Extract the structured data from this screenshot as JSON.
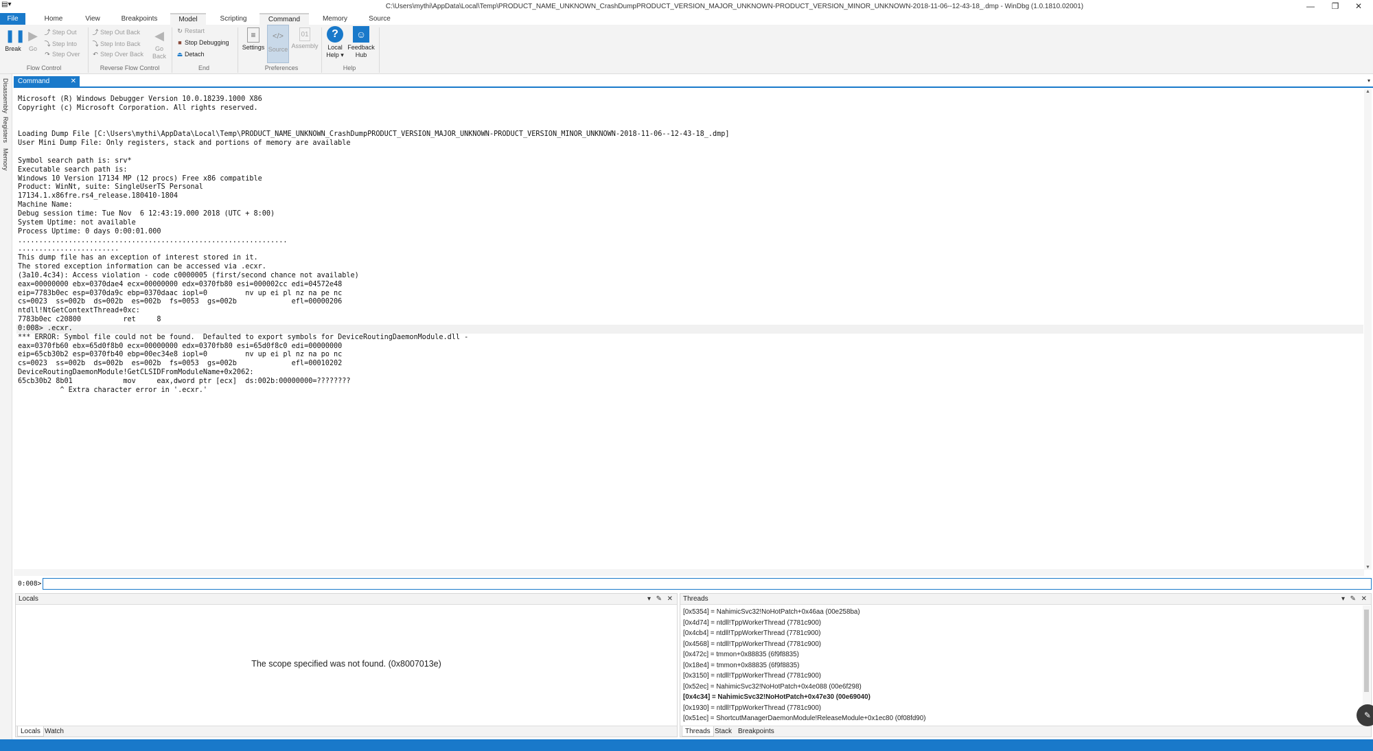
{
  "window": {
    "title": "C:\\Users\\mythi\\AppData\\Local\\Temp\\PRODUCT_NAME_UNKNOWN_CrashDumpPRODUCT_VERSION_MAJOR_UNKNOWN-PRODUCT_VERSION_MINOR_UNKNOWN-2018-11-06--12-43-18_.dmp - WinDbg (1.0.1810.02001)",
    "minimize": "—",
    "maximize": "❐",
    "close": "✕"
  },
  "tabs": [
    "File",
    "Home",
    "View",
    "Breakpoints",
    "Model",
    "Scripting",
    "Command",
    "Memory",
    "Source"
  ],
  "ribbon": {
    "break": "Break",
    "go": "Go",
    "step_out": "Step Out",
    "step_into": "Step Into",
    "step_over": "Step Over",
    "step_out_back": "Step Out Back",
    "step_into_back": "Step Into Back",
    "step_over_back": "Step Over Back",
    "go_back": "Go Back",
    "restart": "Restart",
    "stop_debugging": "Stop Debugging",
    "detach": "Detach",
    "settings": "Settings",
    "source": "Source",
    "assembly": "Assembly",
    "local_help": "Local Help",
    "feedback_hub": "Feedback Hub",
    "groups": {
      "flow_control": "Flow Control",
      "reverse_flow_control": "Reverse Flow Control",
      "end": "End",
      "preferences": "Preferences",
      "help": "Help"
    }
  },
  "command_pane": {
    "tab_label": "Command",
    "rail": [
      "Disassembly",
      "Registers",
      "Memory"
    ],
    "console_lines": [
      "Microsoft (R) Windows Debugger Version 10.0.18239.1000 X86",
      "Copyright (c) Microsoft Corporation. All rights reserved.",
      "",
      "",
      "Loading Dump File [C:\\Users\\mythi\\AppData\\Local\\Temp\\PRODUCT_NAME_UNKNOWN_CrashDumpPRODUCT_VERSION_MAJOR_UNKNOWN-PRODUCT_VERSION_MINOR_UNKNOWN-2018-11-06--12-43-18_.dmp]",
      "User Mini Dump File: Only registers, stack and portions of memory are available",
      "",
      "Symbol search path is: srv*",
      "Executable search path is:",
      "Windows 10 Version 17134 MP (12 procs) Free x86 compatible",
      "Product: WinNt, suite: SingleUserTS Personal",
      "17134.1.x86fre.rs4_release.180410-1804",
      "Machine Name:",
      "Debug session time: Tue Nov  6 12:43:19.000 2018 (UTC + 8:00)",
      "System Uptime: not available",
      "Process Uptime: 0 days 0:00:01.000",
      "................................................................",
      "........................",
      "This dump file has an exception of interest stored in it.",
      "The stored exception information can be accessed via .ecxr.",
      "(3a10.4c34): Access violation - code c0000005 (first/second chance not available)",
      "eax=00000000 ebx=0370dae4 ecx=00000000 edx=0370fb80 esi=000002cc edi=04572e48",
      "eip=7783b0ec esp=0370da9c ebp=0370daac iopl=0         nv up ei pl nz na pe nc",
      "cs=0023  ss=002b  ds=002b  es=002b  fs=0053  gs=002b             efl=00000206",
      "ntdll!NtGetContextThread+0xc:",
      "7783b0ec c20800          ret     8",
      "0:008> .ecxr.",
      "*** ERROR: Symbol file could not be found.  Defaulted to export symbols for DeviceRoutingDaemonModule.dll -",
      "eax=0370fb60 ebx=65d0f8b0 ecx=00000000 edx=0370fb80 esi=65d0f8c0 edi=00000000",
      "eip=65cb30b2 esp=0370fb40 ebp=00ec34e8 iopl=0         nv up ei pl nz na po nc",
      "cs=0023  ss=002b  ds=002b  es=002b  fs=0053  gs=002b             efl=00010202",
      "DeviceRoutingDaemonModule!GetCLSIDFromModuleName+0x2062:",
      "65cb30b2 8b01            mov     eax,dword ptr [ecx]  ds:002b:00000000=????????",
      "          ^ Extra character error in '.ecxr.'"
    ],
    "prompt": "0:008>",
    "input_value": ""
  },
  "locals_pane": {
    "title": "Locals",
    "message": "The scope specified was not found. (0x8007013e)",
    "tabs": [
      "Locals",
      "Watch"
    ]
  },
  "threads_pane": {
    "title": "Threads",
    "threads": [
      "[0x5354] = NahimicSvc32!NoHotPatch+0x46aa (00e258ba)",
      "[0x4d74] = ntdll!TppWorkerThread (7781c900)",
      "[0x4cb4] = ntdll!TppWorkerThread (7781c900)",
      "[0x4568] = ntdll!TppWorkerThread (7781c900)",
      "[0x472c] = tmmon+0x88835 (6f9f8835)",
      "[0x18e4] = tmmon+0x88835 (6f9f8835)",
      "[0x3150] = ntdll!TppWorkerThread (7781c900)",
      "[0x52ec] = NahimicSvc32!NoHotPatch+0x4e088 (00e6f298)",
      "[0x4c34] = NahimicSvc32!NoHotPatch+0x47e30 (00e69040)",
      "[0x1930] = ntdll!TppWorkerThread (7781c900)",
      "[0x51ec] = ShortcutManagerDaemonModule!ReleaseModule+0x1ec80 (0f08fd90)"
    ],
    "current_index": 8,
    "tabs": [
      "Threads",
      "Stack",
      "Breakpoints"
    ]
  },
  "colors": {
    "accent": "#1979ca",
    "ribbon_bg": "#f3f3f3"
  }
}
